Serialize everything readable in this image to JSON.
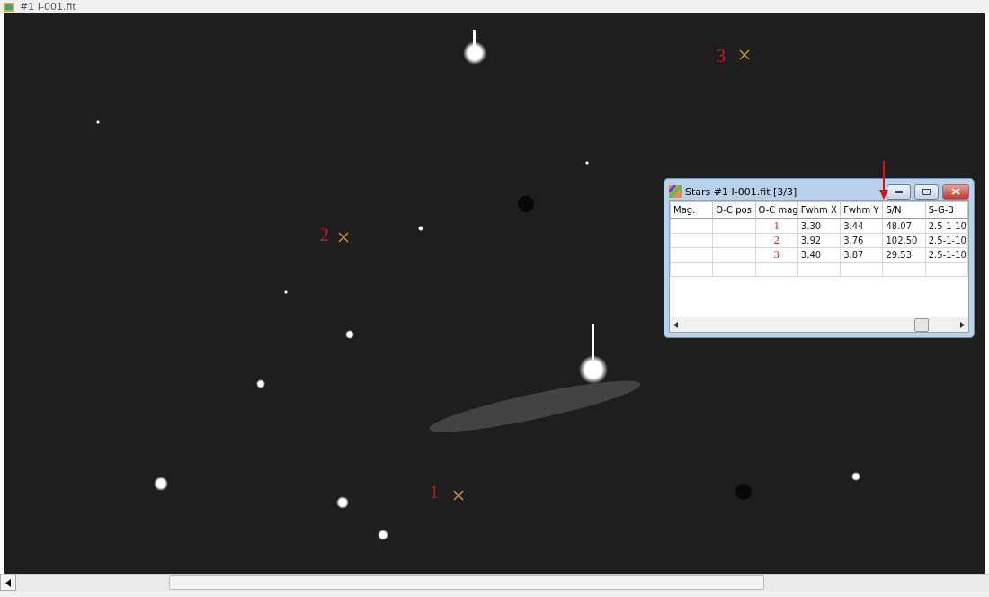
{
  "window": {
    "title": "#1 I-001.fit"
  },
  "image": {
    "markers": [
      {
        "label": "1"
      },
      {
        "label": "2"
      },
      {
        "label": "3"
      }
    ]
  },
  "stars_window": {
    "title": "Stars #1 I-001.fit  [3/3]",
    "columns": [
      "Mag.",
      "O-C pos",
      "O-C mag",
      "Fwhm X",
      "Fwhm Y",
      "S/N",
      "S-G-B"
    ],
    "rows": [
      [
        "",
        "",
        "1",
        "3.30",
        "3.44",
        "48.07",
        "2.5-1-10"
      ],
      [
        "",
        "",
        "2",
        "3.92",
        "3.76",
        "102.50",
        "2.5-1-10"
      ],
      [
        "",
        "",
        "3",
        "3.40",
        "3.87",
        "29.53",
        "2.5-1-10"
      ]
    ]
  }
}
